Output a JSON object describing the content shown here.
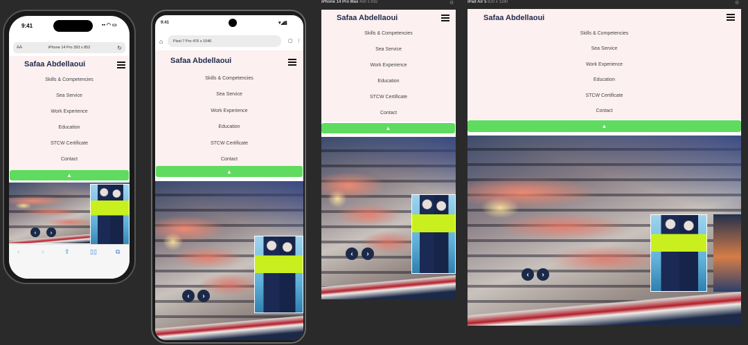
{
  "site": {
    "brand": "Safaa Abdellaoui",
    "menu": [
      "Skills & Competencies",
      "Sea Service",
      "Work Experience",
      "Education",
      "STCW Certificate",
      "Contact"
    ],
    "up_arrow": "▲",
    "prev": "‹",
    "next": "›"
  },
  "iphone14pro": {
    "time": "9:41",
    "address_prefix": "AA",
    "address_text": "iPhone 14 Pro  393 x 852"
  },
  "pixel7pro": {
    "time": "9:41",
    "address_text": "Pixel 7 Pro  476 x 1040"
  },
  "iphone14promax": {
    "device_name": "iPhone 14 Pro Max",
    "dims": "430 x 932"
  },
  "ipadair5": {
    "device_name": "iPad Air 5",
    "dims": "820 x 1180"
  },
  "colors": {
    "page_bg": "#2a2a2b",
    "menu_bg": "#fdf0f0",
    "accent_green": "#5fdb5f",
    "brand_navy": "#1e2a4a"
  }
}
